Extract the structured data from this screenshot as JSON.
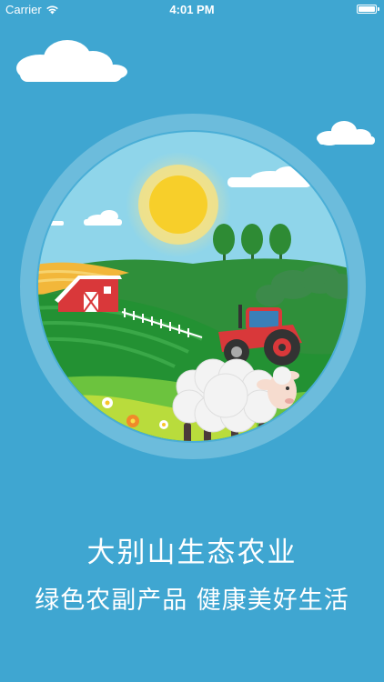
{
  "status_bar": {
    "carrier": "Carrier",
    "time": "4:01 PM",
    "wifi_icon": "wifi-icon",
    "battery_icon": "battery-full-icon"
  },
  "splash": {
    "title": "大别山生态农业",
    "subtitle": "绿色农副产品 健康美好生活",
    "illustration": "farm-scene-with-sheep-and-tractor"
  },
  "colors": {
    "background": "#3fa6d1",
    "text": "#ffffff",
    "sky": "#8fd5ea",
    "sun": "#f7cf2a",
    "grass": "#2f9e3c",
    "barn": "#d9383a",
    "tractor": "#d9383a"
  }
}
